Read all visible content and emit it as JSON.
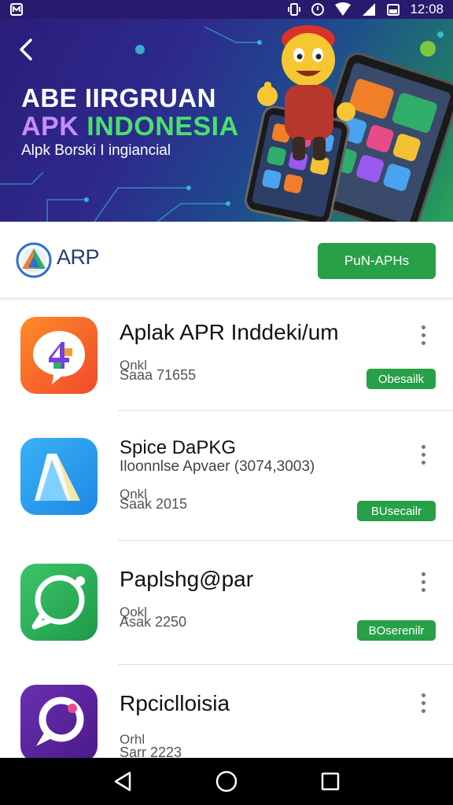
{
  "status_bar": {
    "time": "12:08"
  },
  "hero": {
    "title_line1": "ABE IIRGRUAN",
    "title_line2_a": "APK",
    "title_line2_b": "INDONESIA",
    "subtitle": "Alpk Borski  I ingiancial"
  },
  "header": {
    "brand_name": "ARP",
    "primary_button": "PuN-APHs"
  },
  "apps": [
    {
      "title": "Aplak APR Inddeki/um",
      "desc": "",
      "meta1": "Qnkl",
      "meta2": "Saaa 71655",
      "tag": "Obesailk",
      "icon": "puzzle-chat-icon"
    },
    {
      "title": "Spice DaPKG",
      "desc": "Iloonnlse Apvaer (3074,3003)",
      "meta1": "Qnkl",
      "meta2": "Saak 2015",
      "tag": "BUsecailr",
      "icon": "triangle-document-icon"
    },
    {
      "title": "Paplshg@par",
      "desc": "",
      "meta1": "Qokl",
      "meta2": "Asak 2250",
      "tag": "BOserenilr",
      "icon": "chat-bubble-icon"
    },
    {
      "title": "Rpciclloisia",
      "desc": "",
      "meta1": "Orhl",
      "meta2": "Sarr 2223",
      "tag": "",
      "icon": "purple-bubble-icon"
    }
  ],
  "colors": {
    "accent_green": "#27a048",
    "hero_purple": "#2b1d7a",
    "title_violet": "#c98cff",
    "title_green": "#49e06b"
  },
  "nav": {
    "back": "back-triangle-icon",
    "home": "home-circle-icon",
    "recents": "recents-square-icon"
  }
}
